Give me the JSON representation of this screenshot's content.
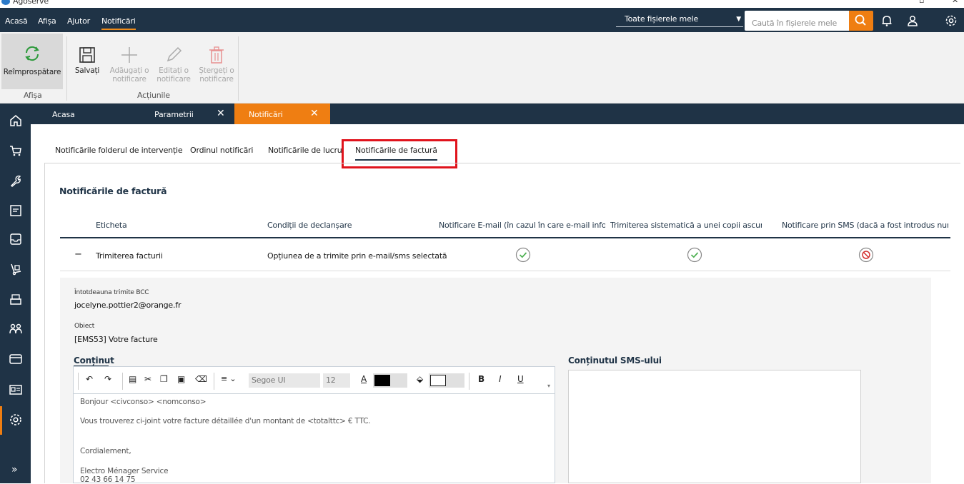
{
  "app": {
    "title": "Agoserve"
  },
  "menu": {
    "items": [
      "Acasă",
      "Afișa",
      "Ajutor",
      "Notificări"
    ],
    "active": "Notificări"
  },
  "header": {
    "scope_selected": "Toate fișierele mele",
    "search_placeholder": "Caută în fișierele mele"
  },
  "ribbon": {
    "refresh_label": "Reîmprospătare",
    "save_label": "Salvați",
    "add_label": "Adăugați o notificare",
    "edit_label": "Editați o notificare",
    "delete_label": "Ștergeți o notificare",
    "group_display": "Afișa",
    "group_actions": "Acțiunile"
  },
  "doc_tabs": [
    {
      "label": "Acasa",
      "closable": false
    },
    {
      "label": "Parametrii",
      "closable": true
    },
    {
      "label": "Notificări",
      "closable": true,
      "active": true
    }
  ],
  "sub_tabs": [
    {
      "label": "Notificările folderul de intervenție"
    },
    {
      "label": "Ordinul notificări"
    },
    {
      "label": "Notificările de lucru"
    },
    {
      "label": "Notificările de factură",
      "active": true
    }
  ],
  "panel": {
    "title": "Notificările de factură",
    "columns": [
      "Eticheta",
      "Condiții de declanșare",
      "Notificare E-mail (în cazul în care e-mail informa",
      "Trimiterea sistematică a unei copii ascunse",
      "Notificare prin SMS (dacă a fost introdus numă"
    ],
    "rows": [
      {
        "toggle": "−",
        "label": "Trimiterea facturii",
        "condition": "Opțiunea de a trimite prin e-mail/sms selectată",
        "email": "check",
        "bcc": "check",
        "sms": "forbidden"
      }
    ]
  },
  "detail": {
    "bcc_label": "Întotdeauna trimite BCC",
    "bcc_value": "jocelyne.pottier2@orange.fr",
    "subject_label": "Obiect",
    "subject_value": "[EMS53] Votre facture",
    "content_head": "Conținut",
    "sms_head": "Conținutul SMS-ului"
  },
  "editor": {
    "font": "Segoe UI",
    "size": "12",
    "lines": [
      "Bonjour <civconso> <nomconso>",
      "Vous trouverez ci-joint votre facture détaillée d'un montant de <totalttc> € TTC.",
      "Cordialement,",
      "Electro Ménager Service",
      "02 43 66 14 75"
    ]
  },
  "colors": {
    "navy": "#1f3346",
    "accent": "#ef7e12",
    "highlight": "#e0131c",
    "ok": "#4caf50",
    "forbid": "#d32f2f"
  }
}
